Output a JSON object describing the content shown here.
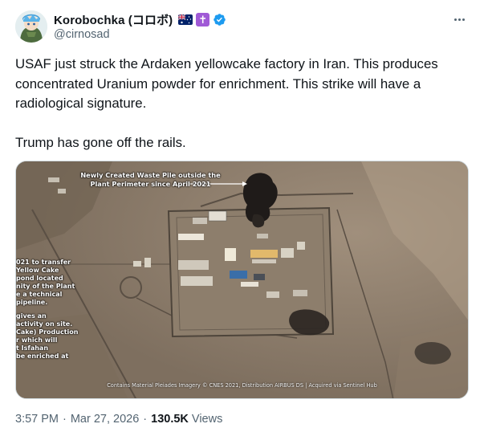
{
  "author": {
    "display_name": "Korobochka (コロボ)",
    "handle": "@cirnosad",
    "badges": [
      "australia-flag-icon",
      "cross-badge-icon",
      "verified-badge-icon"
    ],
    "cross_symbol": "✝"
  },
  "tweet": {
    "paragraph_1": "USAF just struck the Ardaken yellowcake factory in Iran. This produces concentrated Uranium powder for enrichment. This strike will have a radiological signature.",
    "paragraph_2": "Trump has gone off the rails."
  },
  "media": {
    "annotation": "Newly Created Waste Pile outside the Plant Perimeter since April 2021",
    "left_note_lines": [
      "021 to transfer",
      "Yellow Cake",
      " pond located",
      "nity of the Plant",
      "e a technical",
      "pipeline.",
      "",
      "gives an",
      "activity on site.",
      "Cake) Production",
      "r which will",
      "t Isfahan",
      "be enriched at"
    ],
    "credit": "Contains Material Pleiades Imagery © CNES 2021, Distribution AIRBUS DS | Acquired via Sentinel Hub"
  },
  "footer": {
    "time": "3:57 PM",
    "separator": "·",
    "date": "Mar 27, 2026",
    "views_count": "130.5K",
    "views_label": "Views"
  },
  "colors": {
    "text_primary": "#0f1419",
    "text_secondary": "#536471",
    "verified_blue": "#1d9bf0",
    "cross_badge": "#a05ad6",
    "border": "#cfd9de"
  }
}
